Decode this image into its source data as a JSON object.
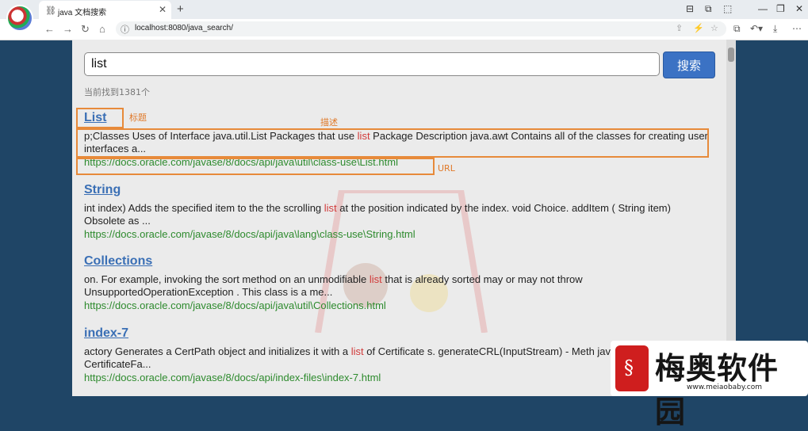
{
  "browser": {
    "tab": {
      "title": "java 文档搜索",
      "favicon": "link-icon",
      "close": "✕"
    },
    "new_tab": "+",
    "window_controls": [
      "⊟",
      "⧉",
      "⬚",
      "—",
      "❐",
      "✕"
    ],
    "nav": {
      "back": "←",
      "forward": "→",
      "reload": "↻",
      "home": "⌂"
    },
    "address": {
      "url": "localhost:8080/java_search/",
      "info": "ⓘ"
    },
    "address_actions": [
      "⇪",
      "⚡",
      "☆"
    ],
    "toolbar": [
      "⧉",
      "↶▾",
      "⤓",
      "⋯"
    ]
  },
  "search": {
    "query": "list",
    "button_label": "搜索"
  },
  "result_count": "当前找到1381个",
  "results": [
    {
      "title": "List",
      "desc_parts": [
        "p;Classes Uses of Interface java.util.List Packages that use ",
        "list",
        "   Package Description java.awt Contains all of the classes for creating user interfaces a..."
      ],
      "url": "https://docs.oracle.com/javase/8/docs/api/java\\util\\class-use\\List.html"
    },
    {
      "title": "String",
      "desc_parts": [
        "int index) Adds the specified item to the the scrolling ",
        "list",
        " at the position indicated by the index. void Choice. addItem ( String  item) Obsolete as ..."
      ],
      "url": "https://docs.oracle.com/javase/8/docs/api/java\\lang\\class-use\\String.html"
    },
    {
      "title": "Collections",
      "desc_parts": [
        "on. For example, invoking the sort method on an unmodifiable ",
        "list",
        " that is already sorted may or may not throw UnsupportedOperationException . This class is a me..."
      ],
      "url": "https://docs.oracle.com/javase/8/docs/api/java\\util\\Collections.html"
    },
    {
      "title": "index-7",
      "desc_parts": [
        "actory Generates a CertPath object and initializes it with a ",
        "list",
        " of Certificate s. generateCRL(InputStream) - Meth java.security.cert. CertificateFa..."
      ],
      "url": "https://docs.oracle.com/javase/8/docs/api/index-files\\index-7.html"
    }
  ],
  "annotations": {
    "title": "标题",
    "desc": "描述",
    "url": "URL"
  },
  "watermark": {
    "logo_glyph": "§",
    "name": "梅奥软件园",
    "url": "www.meiaobaby.com"
  },
  "colors": {
    "accent": "#3b72c4",
    "highlight": "#d13a3a",
    "url_green": "#2d8a2d",
    "annotation": "#e78a3a"
  }
}
